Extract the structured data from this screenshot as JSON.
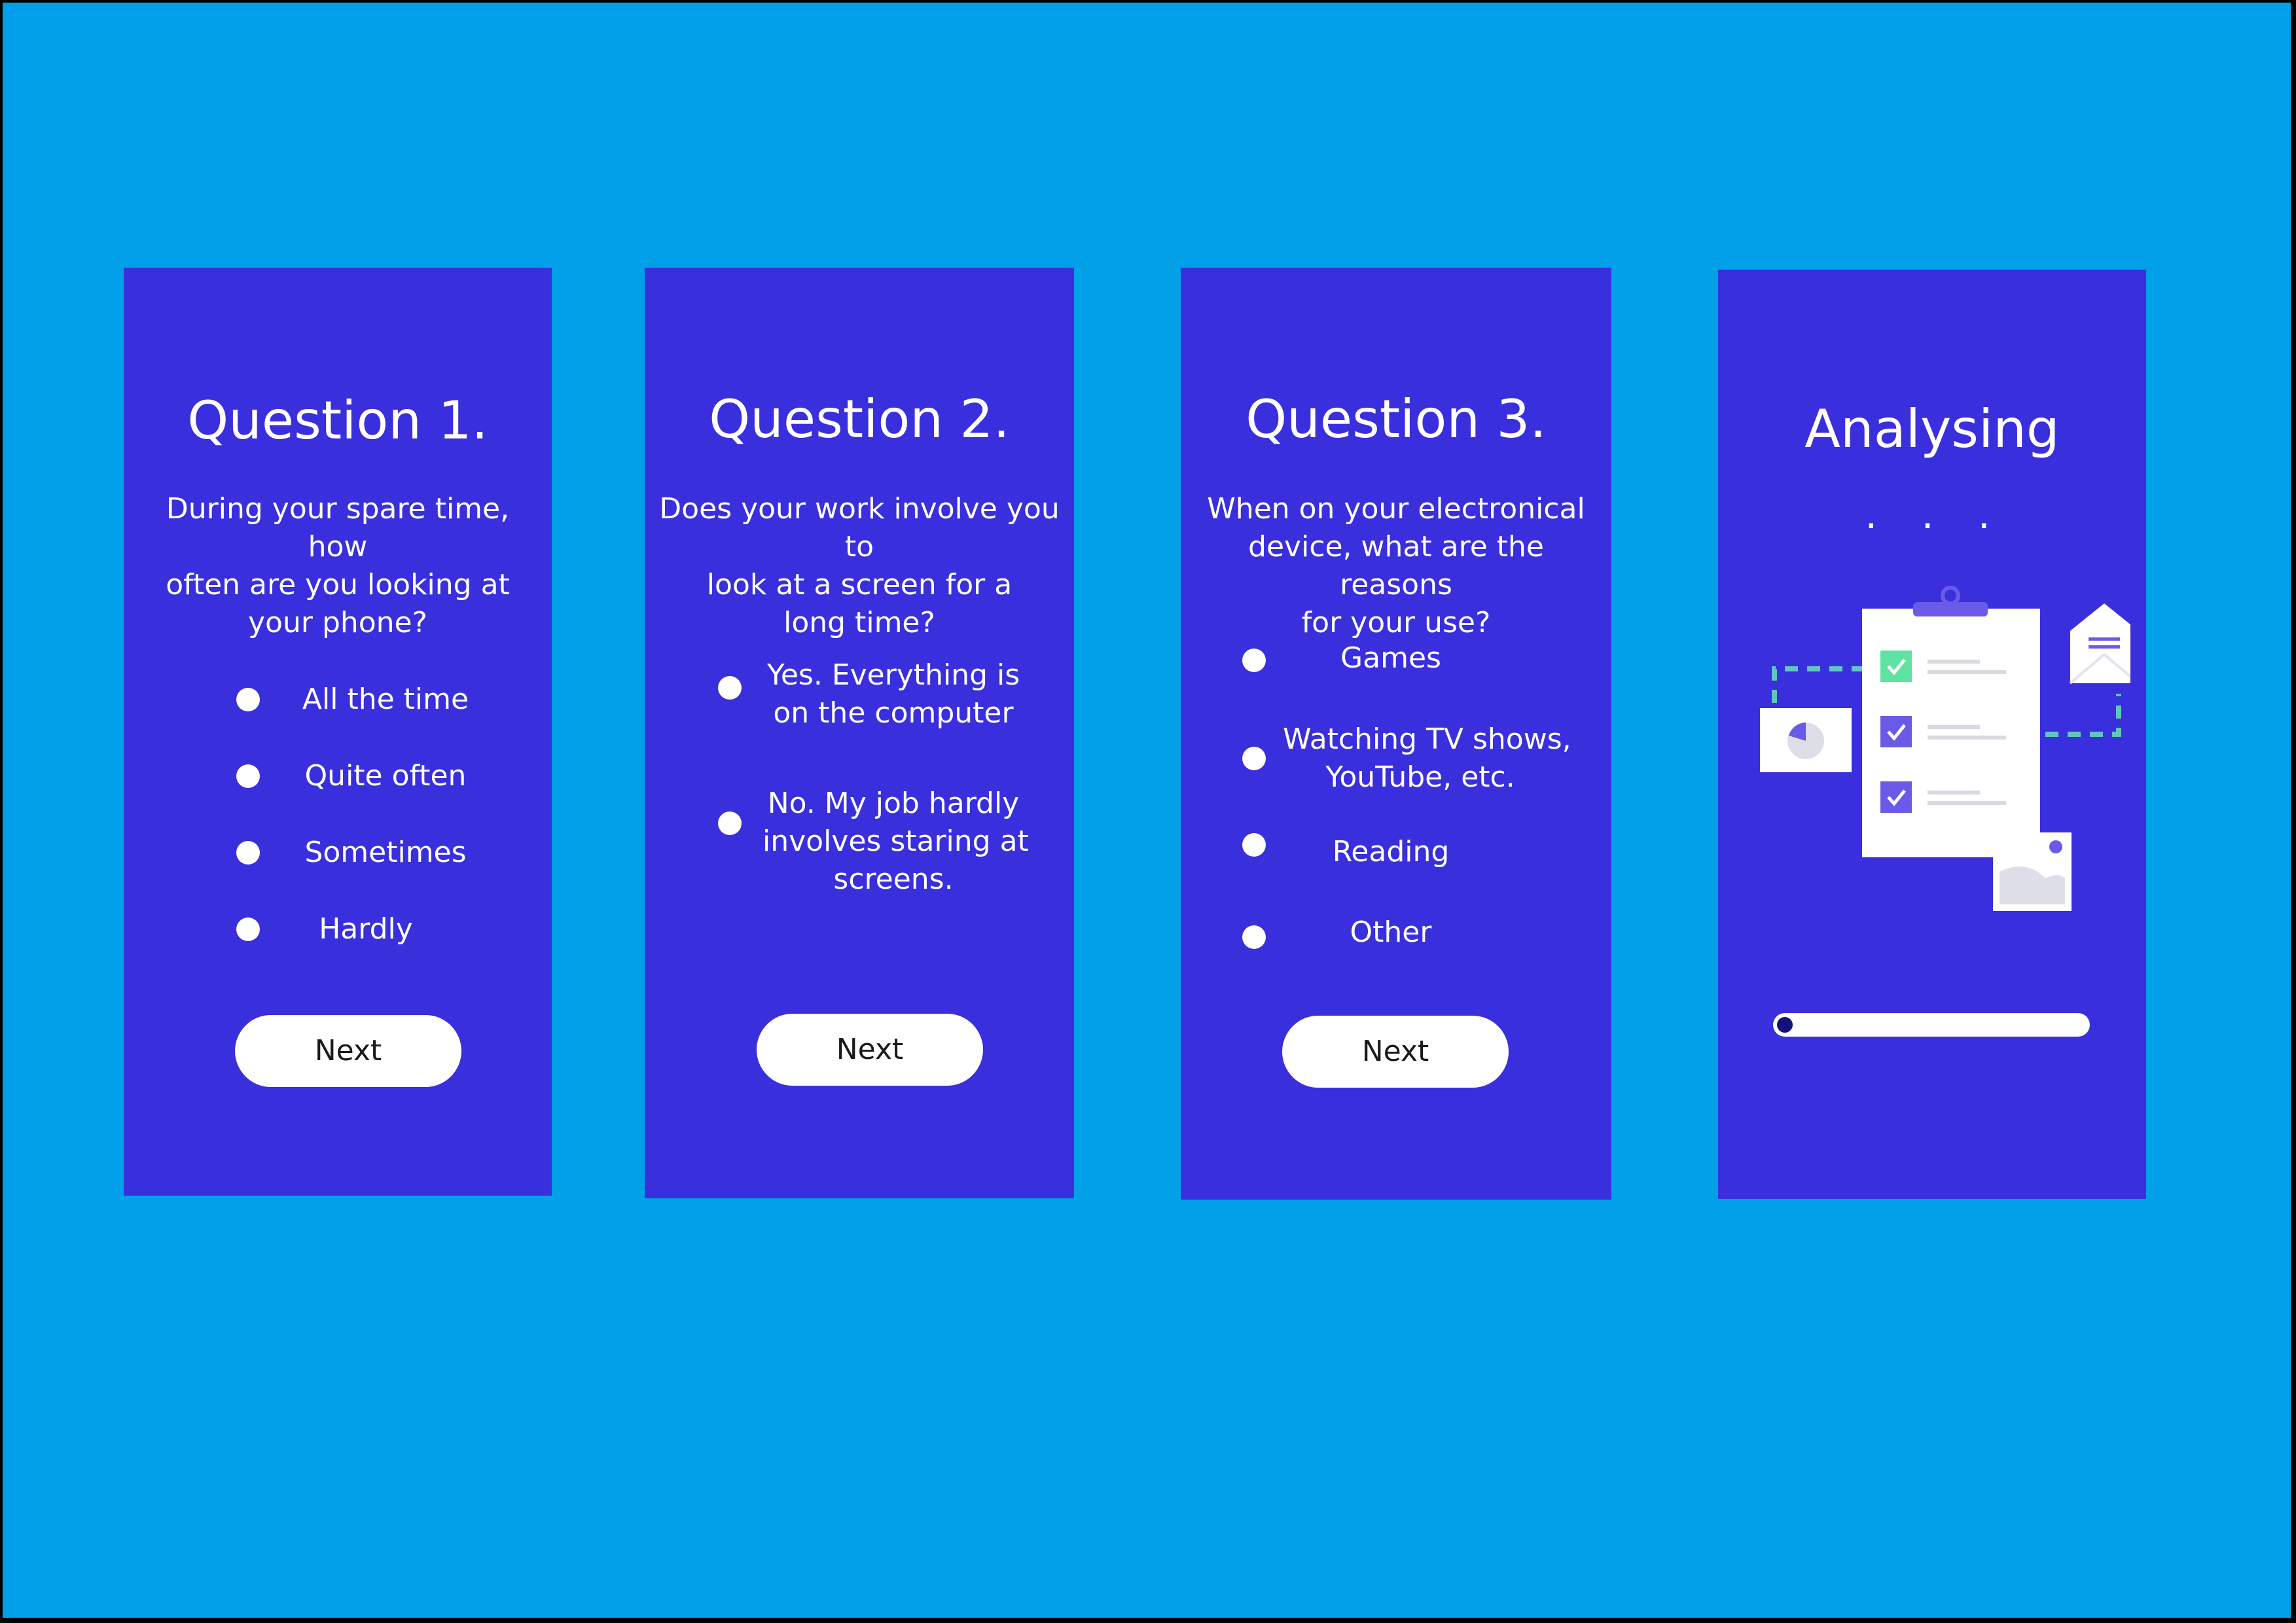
{
  "question_cards": [
    {
      "title": "Question 1.",
      "prompt_lines": [
        "During your spare time, how",
        "often are you looking at",
        "your phone?"
      ],
      "options": [
        {
          "lines": [
            "All the time"
          ]
        },
        {
          "lines": [
            "Quite often"
          ]
        },
        {
          "lines": [
            "Sometimes"
          ]
        },
        {
          "lines": [
            "Hardly"
          ]
        }
      ],
      "next_label": "Next"
    },
    {
      "title": "Question 2.",
      "prompt_lines": [
        "Does your work involve you to",
        "look at a screen for a",
        "long time?"
      ],
      "options": [
        {
          "lines": [
            "Yes. Everything is",
            "on the computer"
          ]
        },
        {
          "lines": [
            "No. My job hardly",
            "involves staring at",
            "screens."
          ]
        }
      ],
      "next_label": "Next"
    },
    {
      "title": "Question 3.",
      "prompt_lines": [
        "When on your electronical",
        "device, what are the reasons",
        "for your use?"
      ],
      "options": [
        {
          "lines": [
            "Games"
          ]
        },
        {
          "lines": [
            "Watching TV shows,",
            "YouTube, etc."
          ]
        },
        {
          "lines": [
            "Reading"
          ]
        },
        {
          "lines": [
            "Other"
          ]
        }
      ],
      "next_label": "Next"
    }
  ],
  "analysing_card": {
    "title": "Analysing",
    "dots": ". . .",
    "progress_fraction": 0.02,
    "illustration_icon": "survey-clipboard-illustration"
  },
  "colors": {
    "background": "#02a0e8",
    "card": "#3a2fdc",
    "button": "#ffffff",
    "radio": "#ffffff",
    "check_green": "#5ee3a1",
    "check_purple": "#6a5ae8"
  }
}
